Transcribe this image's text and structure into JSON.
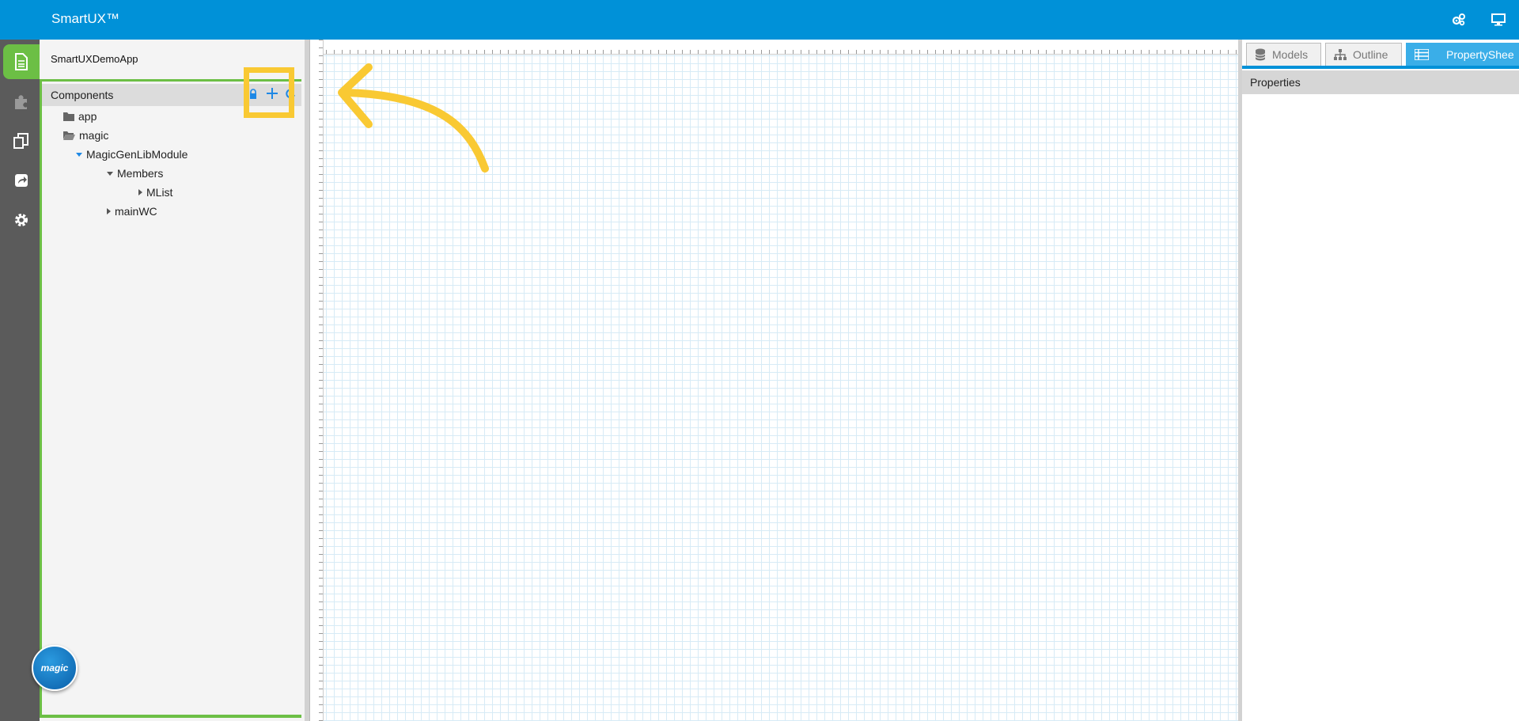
{
  "header": {
    "app_title": "SmartUX™",
    "icons": [
      "settings-cogs-icon",
      "monitor-icon"
    ]
  },
  "left_nav": {
    "items": [
      {
        "icon": "document-icon",
        "active": true
      },
      {
        "icon": "puzzle-icon",
        "active": false
      },
      {
        "icon": "copy-pages-icon",
        "active": false
      },
      {
        "icon": "share-icon",
        "active": false
      },
      {
        "icon": "gear-icon",
        "active": false
      }
    ]
  },
  "left_panel": {
    "app_name": "SmartUXDemoApp",
    "components_title": "Components",
    "toolbar_icons": [
      "lock-icon",
      "add-icon",
      "refresh-icon"
    ],
    "tree": [
      {
        "label": "app",
        "icon": "folder-closed-icon"
      },
      {
        "label": "magic",
        "icon": "folder-open-icon"
      },
      {
        "label": "MagicGenLibModule",
        "expanded": true
      },
      {
        "label": "Members",
        "expanded": true
      },
      {
        "label": "MList",
        "expanded": false
      },
      {
        "label": "mainWC",
        "expanded": false
      }
    ]
  },
  "right_panel": {
    "tabs": [
      {
        "label": "Models",
        "icon": "database-icon",
        "active": false
      },
      {
        "label": "Outline",
        "icon": "sitemap-icon",
        "active": false
      },
      {
        "label": "PropertyShee",
        "icon": "list-icon",
        "active": true
      }
    ],
    "properties_title": "Properties"
  },
  "logo": {
    "text": "magic"
  },
  "colors": {
    "brand_blue": "#0091d8",
    "active_green": "#6cbf45",
    "highlight_yellow": "#f9c933",
    "grid_line": "#d7ebf6"
  }
}
